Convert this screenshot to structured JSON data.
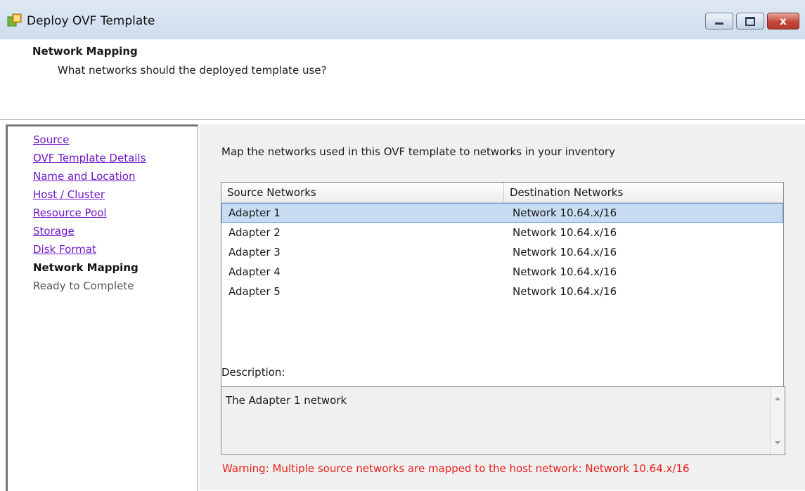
{
  "window": {
    "title": "Deploy OVF Template",
    "close_label": "x"
  },
  "header": {
    "title": "Network Mapping",
    "subtitle": "What networks should the deployed template use?"
  },
  "nav": {
    "items": [
      {
        "label": "Source",
        "state": "link"
      },
      {
        "label": "OVF Template Details",
        "state": "link"
      },
      {
        "label": "Name and Location",
        "state": "link"
      },
      {
        "label": "Host / Cluster",
        "state": "link"
      },
      {
        "label": "Resource Pool",
        "state": "link"
      },
      {
        "label": "Storage",
        "state": "link"
      },
      {
        "label": "Disk Format",
        "state": "link"
      },
      {
        "label": "Network Mapping",
        "state": "current"
      },
      {
        "label": "Ready to Complete",
        "state": "pending"
      }
    ]
  },
  "main": {
    "instruction": "Map the networks used in this OVF template to networks in your inventory",
    "table": {
      "columns": [
        "Source Networks",
        "Destination Networks"
      ],
      "rows": [
        {
          "source": "Adapter 1",
          "destination": "Network 10.64.x/16",
          "selected": true
        },
        {
          "source": "Adapter 2",
          "destination": "Network 10.64.x/16",
          "selected": false
        },
        {
          "source": "Adapter 3",
          "destination": "Network 10.64.x/16",
          "selected": false
        },
        {
          "source": "Adapter 4",
          "destination": "Network 10.64.x/16",
          "selected": false
        },
        {
          "source": "Adapter 5",
          "destination": "Network 10.64.x/16",
          "selected": false
        }
      ]
    },
    "description_label": "Description:",
    "description_text": "The Adapter 1 network",
    "warning": "Warning: Multiple source networks are mapped to the host network: Network 10.64.x/16"
  },
  "colors": {
    "link": "#6f17c7",
    "warning": "#e8201c",
    "selection": "#c7dcf3"
  }
}
